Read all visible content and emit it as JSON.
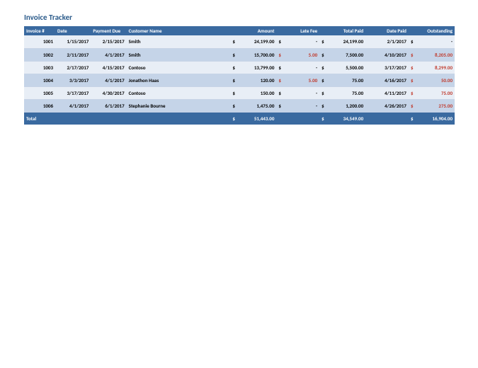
{
  "title": "Invoice Tracker",
  "headers": {
    "invoice": "Invoice #",
    "date": "Date",
    "due": "Payment Due",
    "name": "Customer Name",
    "amount": "Amount",
    "fee": "Late Fee",
    "paid": "Total Paid",
    "dpaid": "Date Paid",
    "out": "Outstanding"
  },
  "rows": [
    {
      "inv": "1001",
      "date": "1/15/2017",
      "due": "2/15/2017",
      "name": "Smith",
      "amt": "24,199.00",
      "fee": "-",
      "fee_neg": false,
      "paid": "24,199.00",
      "dpaid": "2/1/2017",
      "out": "-",
      "out_neg": false
    },
    {
      "inv": "1002",
      "date": "2/11/2017",
      "due": "4/1/2017",
      "name": "Smith",
      "amt": "15,700.00",
      "fee": "5.00",
      "fee_neg": true,
      "paid": "7,500.00",
      "dpaid": "4/10/2017",
      "out": "8,205.00",
      "out_neg": true
    },
    {
      "inv": "1003",
      "date": "2/17/2017",
      "due": "4/15/2017",
      "name": "Contoso",
      "amt": "13,799.00",
      "fee": "-",
      "fee_neg": false,
      "paid": "5,500.00",
      "dpaid": "3/17/2017",
      "out": "8,299.00",
      "out_neg": true
    },
    {
      "inv": "1004",
      "date": "3/3/2017",
      "due": "4/1/2017",
      "name": "Jonathon Haas",
      "amt": "120.00",
      "fee": "5.00",
      "fee_neg": true,
      "paid": "75.00",
      "dpaid": "4/16/2017",
      "out": "50.00",
      "out_neg": true
    },
    {
      "inv": "1005",
      "date": "3/17/2017",
      "due": "4/30/2017",
      "name": "Contoso",
      "amt": "150.00",
      "fee": "-",
      "fee_neg": false,
      "paid": "75.00",
      "dpaid": "4/11/2017",
      "out": "75.00",
      "out_neg": true
    },
    {
      "inv": "1006",
      "date": "4/1/2017",
      "due": "6/1/2017",
      "name": "Stephanie Bourne",
      "amt": "1,475.00",
      "fee": "-",
      "fee_neg": false,
      "paid": "1,200.00",
      "dpaid": "4/26/2017",
      "out": "275.00",
      "out_neg": true
    }
  ],
  "total": {
    "label": "Total",
    "amt": "51,443.00",
    "paid": "34,549.00",
    "out": "16,904.00"
  }
}
